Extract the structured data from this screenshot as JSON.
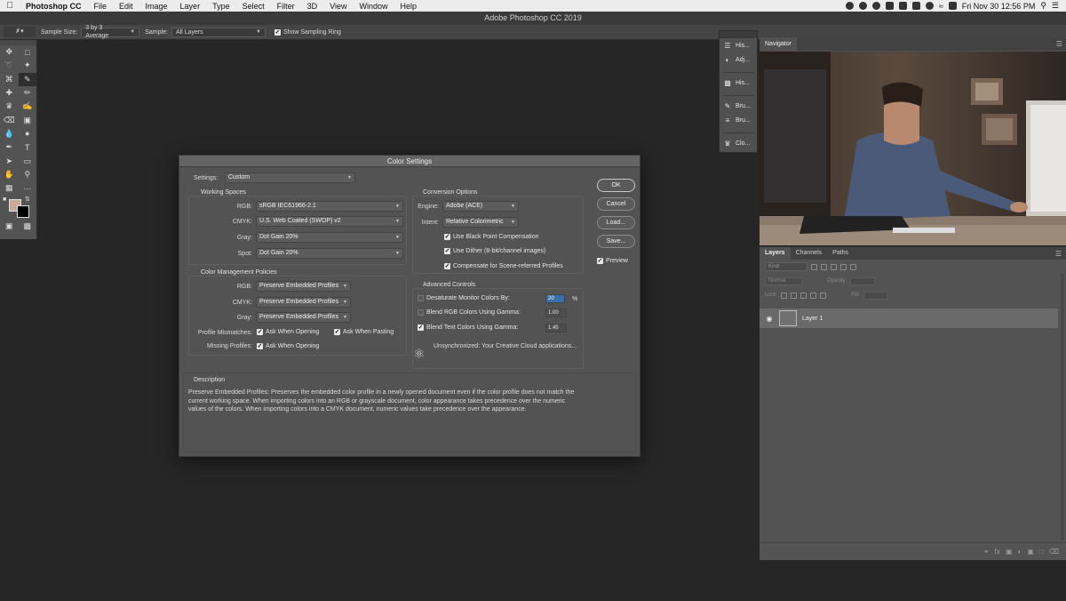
{
  "menubar": {
    "app_name": "Photoshop CC",
    "items": [
      "File",
      "Edit",
      "Image",
      "Layer",
      "Type",
      "Select",
      "Filter",
      "3D",
      "View",
      "Window",
      "Help"
    ],
    "clock": "Fri Nov 30  12:56 PM"
  },
  "app_title": "Adobe Photoshop CC 2019",
  "options_bar": {
    "sample_size_label": "Sample Size:",
    "sample_size_value": "3 by 3 Average",
    "sample_label": "Sample:",
    "sample_value": "All Layers",
    "show_ring_label": "Show Sampling Ring",
    "show_ring_checked": true
  },
  "toolbar": {
    "foreground_color": "#c9aa98",
    "background_color": "#000000"
  },
  "dock": {
    "items": [
      "His...",
      "Adj...",
      "His...",
      "Bru...",
      "Bru...",
      "Clo..."
    ]
  },
  "navigator": {
    "tab": "Navigator"
  },
  "layers_panel": {
    "tabs": [
      "Layers",
      "Channels",
      "Paths"
    ],
    "kind_placeholder": "Kind",
    "blend_mode": "Normal",
    "opacity_label": "Opacity:",
    "lock_label": "Lock:",
    "fill_label": "Fill:",
    "layer_name": "Layer 1"
  },
  "dialog": {
    "title": "Color Settings",
    "settings_label": "Settings:",
    "settings_value": "Custom",
    "working_spaces": {
      "title": "Working Spaces",
      "rgb_label": "RGB:",
      "rgb_value": "sRGB IEC61966-2.1",
      "cmyk_label": "CMYK:",
      "cmyk_value": "U.S. Web Coated (SWOP) v2",
      "gray_label": "Gray:",
      "gray_value": "Dot Gain 20%",
      "spot_label": "Spot:",
      "spot_value": "Dot Gain 20%"
    },
    "policies": {
      "title": "Color Management Policies",
      "rgb_label": "RGB:",
      "rgb_value": "Preserve Embedded Profiles",
      "cmyk_label": "CMYK:",
      "cmyk_value": "Preserve Embedded Profiles",
      "gray_label": "Gray:",
      "gray_value": "Preserve Embedded Profiles",
      "mismatch_label": "Profile Mismatches:",
      "ask_opening": "Ask When Opening",
      "ask_pasting": "Ask When Pasting",
      "missing_label": "Missing Profiles:",
      "ask_opening_missing": "Ask When Opening"
    },
    "conversion": {
      "title": "Conversion Options",
      "engine_label": "Engine:",
      "engine_value": "Adobe (ACE)",
      "intent_label": "Intent:",
      "intent_value": "Relative Colorimetric",
      "black_point": "Use Black Point Compensation",
      "dither": "Use Dither (8-bit/channel images)",
      "compensate": "Compensate for Scene-referred Profiles"
    },
    "advanced": {
      "title": "Advanced Controls",
      "desaturate": "Desaturate Monitor Colors By:",
      "desaturate_value": "20",
      "desaturate_unit": "%",
      "blend_rgb": "Blend RGB Colors Using Gamma:",
      "blend_rgb_value": "1.00",
      "blend_text": "Blend Text Colors Using Gamma:",
      "blend_text_value": "1.45"
    },
    "sync_status": "Unsynchronized: Your Creative Cloud applications...",
    "description_title": "Description",
    "description_text": "Preserve Embedded Profiles:  Preserves the embedded color profile in a newly opened document even if the color profile does not match the current working space.  When importing colors into an RGB or grayscale document, color appearance takes precedence over the numeric values of the colors.  When importing colors into a CMYK document, numeric values take precedence over the appearance.",
    "buttons": {
      "ok": "OK",
      "cancel": "Cancel",
      "load": "Load...",
      "save": "Save..."
    },
    "preview_label": "Preview"
  }
}
